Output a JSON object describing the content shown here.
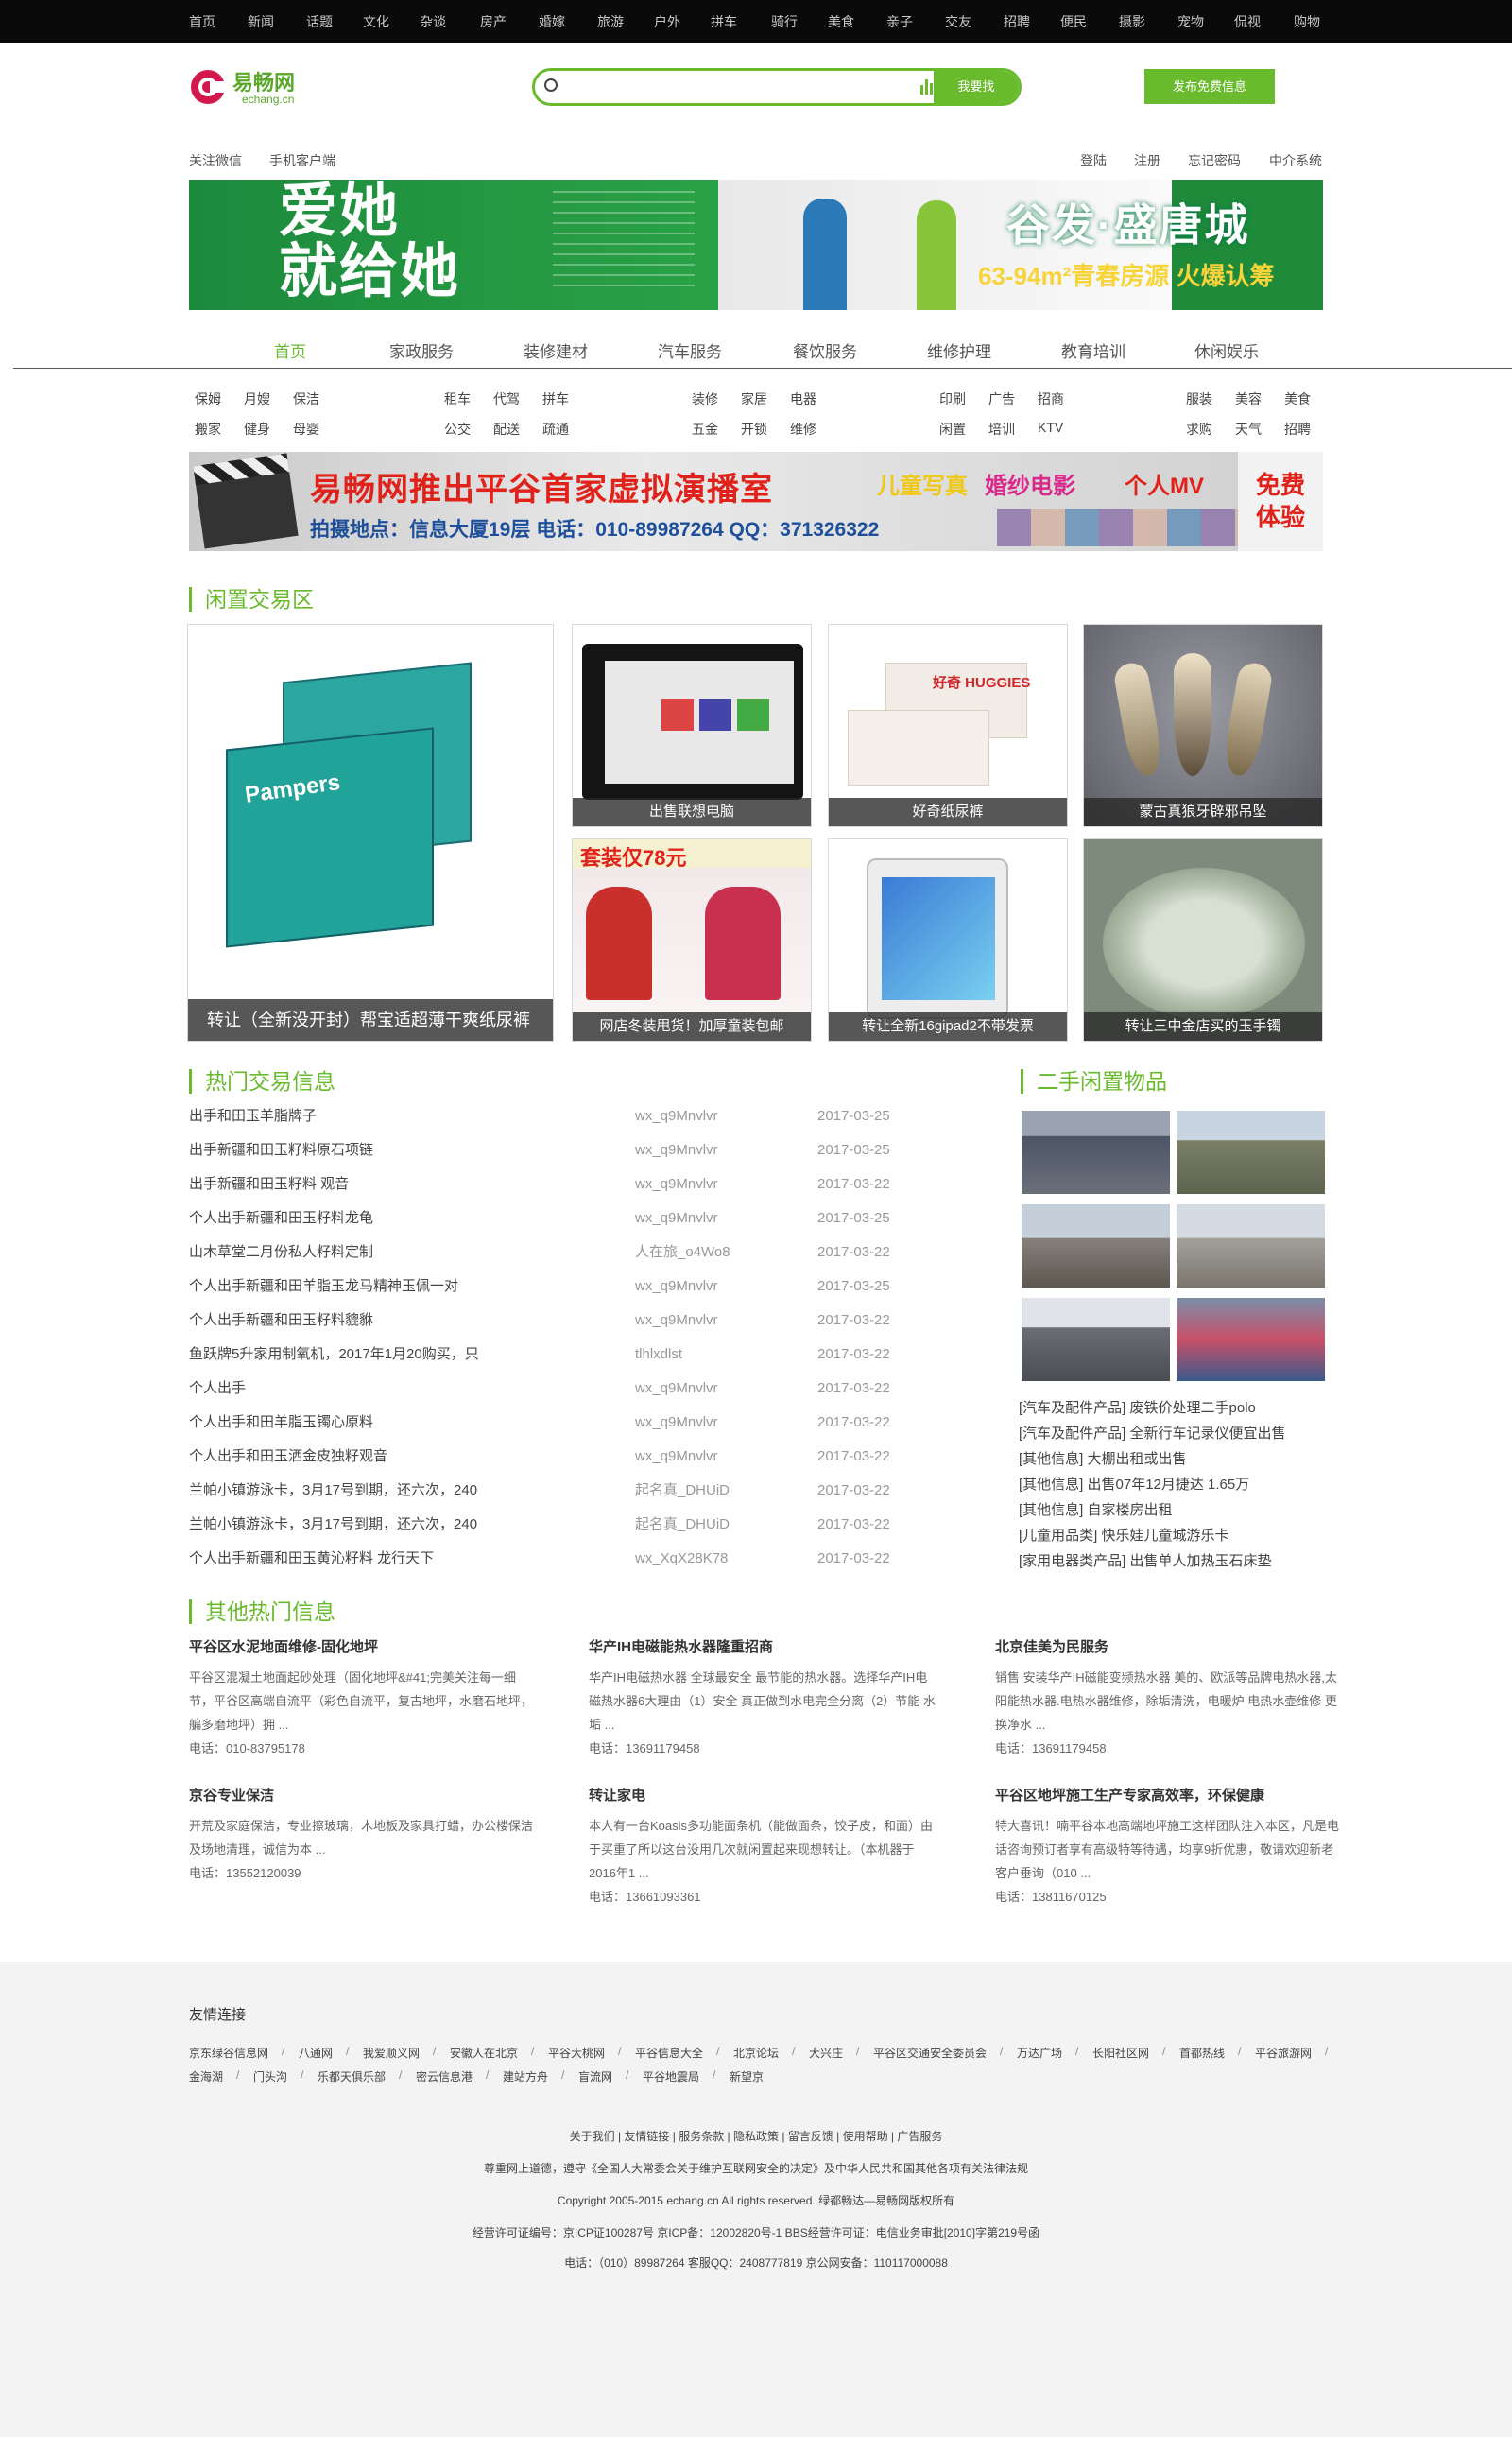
{
  "top_nav": [
    "首页",
    "新闻",
    "话题",
    "文化",
    "杂谈",
    "房产",
    "婚嫁",
    "旅游",
    "户外",
    "拼车",
    "骑行",
    "美食",
    "亲子",
    "交友",
    "招聘",
    "便民",
    "摄影",
    "宠物",
    "侃视",
    "购物"
  ],
  "logo": {
    "cn": "易畅网",
    "en": "echang.cn"
  },
  "search": {
    "placeholder": "",
    "button": "我要找"
  },
  "publish_button": "发布免费信息",
  "sub_left": [
    "关注微信",
    "手机客户端"
  ],
  "sub_right": [
    "登陆",
    "注册",
    "忘记密码",
    "中介系统"
  ],
  "banner1": {
    "left": "爱她\n就给她",
    "right_title": "谷发·盛唐城",
    "right_sub": "63-94m²青春房源 火爆认筹"
  },
  "nav_tabs": [
    "首页",
    "家政服务",
    "装修建材",
    "汽车服务",
    "餐饮服务",
    "维修护理",
    "教育培训",
    "休闲娱乐"
  ],
  "sub_cats": [
    [
      "保姆",
      "月嫂",
      "保洁"
    ],
    [
      "搬家",
      "健身",
      "母婴"
    ],
    [
      "租车",
      "代驾",
      "拼车"
    ],
    [
      "公交",
      "配送",
      "疏通"
    ],
    [
      "装修",
      "家居",
      "电器"
    ],
    [
      "五金",
      "开锁",
      "维修"
    ],
    [
      "印刷",
      "广告",
      "招商"
    ],
    [
      "闲置",
      "培训",
      "KTV"
    ],
    [
      "服装",
      "美容",
      "美食"
    ],
    [
      "求购",
      "天气",
      "招聘"
    ]
  ],
  "banner2": {
    "title": "易畅网推出平谷首家虚拟演播室",
    "tags": [
      "儿童写真",
      "婚纱电影",
      "个人MV"
    ],
    "sub": "拍摄地点：信息大厦19层  电话：010-89987264 QQ：371326322",
    "badge": "免费\n体验"
  },
  "sections": {
    "idle": "闲置交易区",
    "hot": "热门交易信息",
    "second": "二手闲置物品",
    "other": "其他热门信息"
  },
  "idle_items": [
    {
      "caption": "转让（全新没开封）帮宝适超薄干爽纸尿裤"
    },
    {
      "caption": "出售联想电脑"
    },
    {
      "caption": "好奇纸尿裤"
    },
    {
      "caption": "蒙古真狼牙辟邪吊坠"
    },
    {
      "caption": "网店冬装甩货！加厚童装包邮"
    },
    {
      "caption": "转让全新16gipad2不带发票"
    },
    {
      "caption": "转让三中金店买的玉手镯"
    }
  ],
  "idle_img_text": {
    "sale": "套装仅78元",
    "huggies": "好奇 HUGGIES",
    "pampers": "Pampers"
  },
  "hot_rows": [
    {
      "title": "出手和田玉羊脂牌子",
      "user": "wx_q9Mnvlvr",
      "date": "2017-03-25"
    },
    {
      "title": "出手新疆和田玉籽料原石项链",
      "user": "wx_q9Mnvlvr",
      "date": "2017-03-25"
    },
    {
      "title": "出手新疆和田玉籽料 观音",
      "user": "wx_q9Mnvlvr",
      "date": "2017-03-22"
    },
    {
      "title": "个人出手新疆和田玉籽料龙龟",
      "user": "wx_q9Mnvlvr",
      "date": "2017-03-25"
    },
    {
      "title": "山木草堂二月份私人籽料定制",
      "user": "人在旅_o4Wo8",
      "date": "2017-03-22"
    },
    {
      "title": "个人出手新疆和田羊脂玉龙马精神玉佩一对",
      "user": "wx_q9Mnvlvr",
      "date": "2017-03-25"
    },
    {
      "title": "个人出手新疆和田玉籽料貔貅",
      "user": "wx_q9Mnvlvr",
      "date": "2017-03-22"
    },
    {
      "title": "鱼跃牌5升家用制氧机，2017年1月20购买，只",
      "user": "tlhlxdlst",
      "date": "2017-03-22"
    },
    {
      "title": "个人出手",
      "user": "wx_q9Mnvlvr",
      "date": "2017-03-22"
    },
    {
      "title": "个人出手和田羊脂玉镯心原料",
      "user": "wx_q9Mnvlvr",
      "date": "2017-03-22"
    },
    {
      "title": "个人出手和田玉洒金皮独籽观音",
      "user": "wx_q9Mnvlvr",
      "date": "2017-03-22"
    },
    {
      "title": "兰帕小镇游泳卡，3月17号到期，还六次，240",
      "user": "起名真_DHUiD",
      "date": "2017-03-22"
    },
    {
      "title": "兰帕小镇游泳卡，3月17号到期，还六次，240",
      "user": "起名真_DHUiD",
      "date": "2017-03-22"
    },
    {
      "title": "个人出手新疆和田玉黄沁籽料 龙行天下",
      "user": "wx_XqX28K78",
      "date": "2017-03-22"
    }
  ],
  "second_links": [
    "[汽车及配件产品] 废铁价处理二手polo",
    "[汽车及配件产品] 全新行车记录仪便宜出售",
    "[其他信息] 大棚出租或出售",
    "[其他信息] 出售07年12月捷达 1.65万",
    "[其他信息] 自家楼房出租",
    "[儿童用品类] 快乐娃儿童城游乐卡",
    "[家用电器类产品] 出售单人加热玉石床垫"
  ],
  "other_items": [
    {
      "title": "平谷区水泥地面维修-固化地坪",
      "body": "平谷区混凝土地面起砂处理（固化地坪&#41;完美关注每一细节，平谷区高端自流平（彩色自流平，复古地坪，水磨石地坪，艑多磨地坪）拥 ...",
      "phone": "电话：010-83795178"
    },
    {
      "title": "华产IH电磁能热水器隆重招商",
      "body": "华产IH电磁热水器 全球最安全 最节能的热水器。选择华产IH电磁热水器6大理由（1）安全 真正做到水电完全分离（2）节能 水垢 ...",
      "phone": "电话：13691179458"
    },
    {
      "title": "北京佳美为民服务",
      "body": "销售 安装华产IH磁能变频热水器 美的、欧派等品牌电热水器,太阳能热水器.电热水器维修，除垢清洗，电暖炉 电热水壶维修 更换净水 ...",
      "phone": "电话：13691179458"
    },
    {
      "title": "京谷专业保洁",
      "body": "开荒及家庭保洁，专业擦玻璃，木地板及家具打蜡，办公楼保洁及场地清理，诚信为本 ...",
      "phone": "电话：13552120039"
    },
    {
      "title": "转让家电",
      "body": "本人有一台Koasis多功能面条机（能做面条，饺子皮，和面）由于买重了所以这台没用几次就闲置起来现想转让。（本机器于2016年1 ...",
      "phone": "电话：13661093361"
    },
    {
      "title": "平谷区地坪施工生产专家高效率，环保健康",
      "body": "特大喜讯！喃平谷本地高端地坪施工这样团队注入本区，凡是电话咨询预订者享有高级特等待遇，均享9折优惠，敬请欢迎新老客户垂询（010 ...",
      "phone": "电话：13811670125"
    }
  ],
  "footer": {
    "friend_title": "友情连接",
    "friend_links": [
      "京东绿谷信息网",
      "八通网",
      "我爱顺义网",
      "安徽人在北京",
      "平谷大桃网",
      "平谷信息大全",
      "北京论坛",
      "大兴庄",
      "平谷区交通安全委员会",
      "万达广场",
      "长阳社区网",
      "首都热线",
      "平谷旅游网",
      "金海湖",
      "门头沟",
      "乐都天俱乐部",
      "密云信息港",
      "建站方舟",
      "盲流网",
      "平谷地震局",
      "新望京"
    ],
    "bottom_links": "关于我们 | 友情链接 | 服务条款 | 隐私政策 | 留言反馈 | 使用帮助 | 广告服务",
    "notice": "尊重网上道德，遵守《全国人大常委会关于维护互联网安全的决定》及中华人民共和国其他各项有关法律法规",
    "copyright": "Copyright 2005-2015 echang.cn All rights reserved. 绿都畅达—易畅网版权所有",
    "license": "经营许可证编号：京ICP证100287号 京ICP备：12002820号-1 BBS经营许可证：电信业务审批[2010]字第219号函",
    "contact": "电话：（010）89987264 客服QQ：2408777819 京公网安备：110117000088"
  }
}
